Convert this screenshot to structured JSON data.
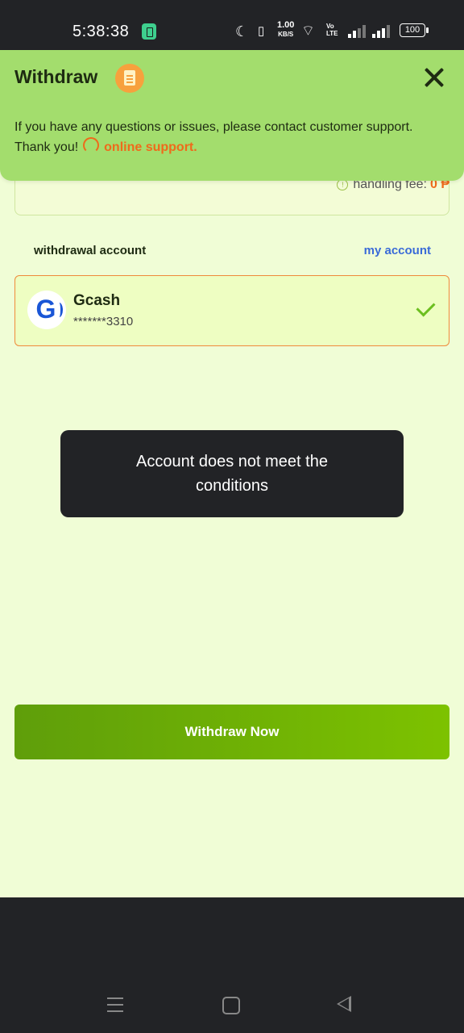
{
  "status_bar": {
    "time": "5:38:38",
    "speed_value": "1.00",
    "speed_unit": "KB/S",
    "volte": "Vo LTE",
    "battery": "100",
    "icons": [
      "battery-saver-icon",
      "moon-icon",
      "vibrate-icon",
      "wifi-icon",
      "signal-icon",
      "battery-icon"
    ]
  },
  "header": {
    "title": "Withdraw",
    "notice": "If you have any questions or issues, please contact customer support. Thank you!",
    "support_link": "online support.",
    "bg_color": "#a3dd6d"
  },
  "fee": {
    "label": "handling fee:",
    "value": "0 ₱"
  },
  "withdrawal_account": {
    "label": "withdrawal account",
    "my_account_link": "my account"
  },
  "account": {
    "name": "Gcash",
    "number": "*******3310",
    "selected": true
  },
  "toast": {
    "message": "Account does not meet the conditions"
  },
  "withdraw_button": {
    "label": "Withdraw Now"
  },
  "colors": {
    "accent": "#ef6a1b",
    "link": "#3a6bd8",
    "button": "#6fb000",
    "page_bg": "#f0fdd6"
  }
}
